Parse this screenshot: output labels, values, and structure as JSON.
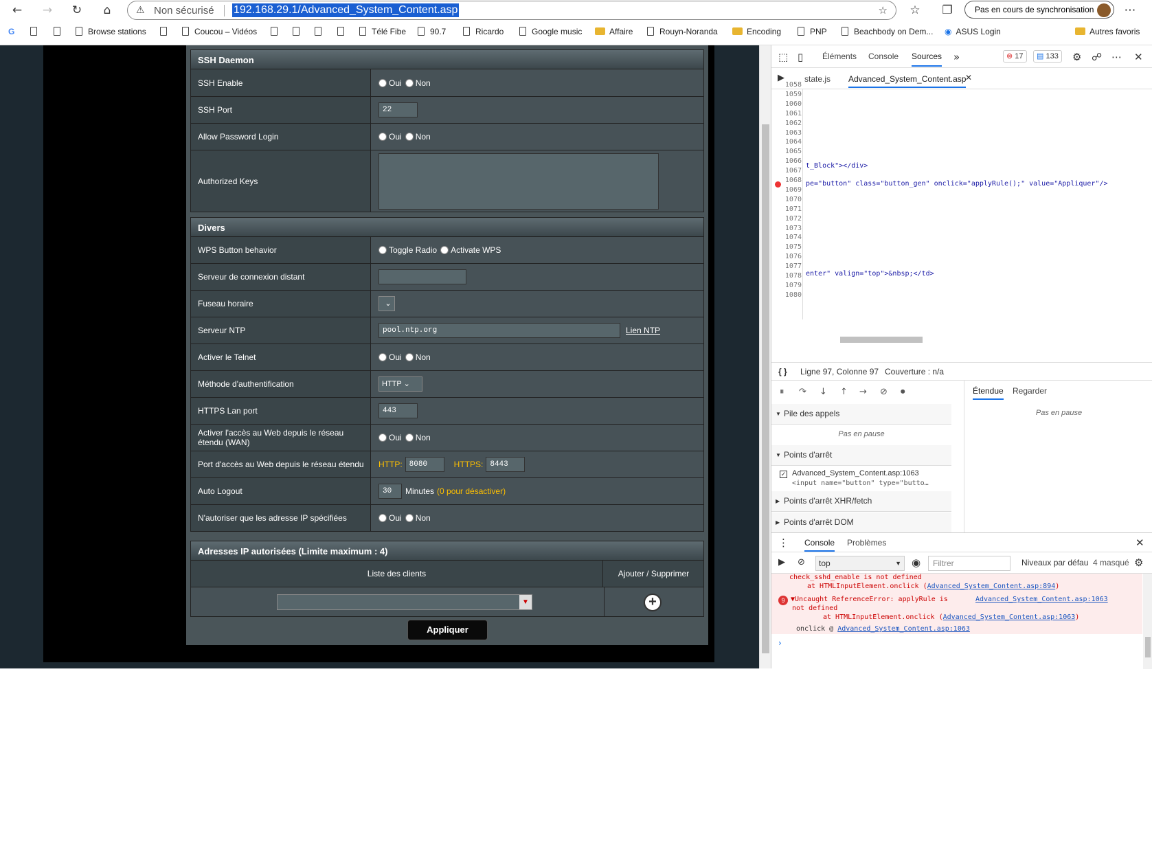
{
  "browser": {
    "not_secure": "Non sécurisé",
    "url": "192.168.29.1/Advanced_System_Content.asp",
    "sync": "Pas en cours de synchronisation",
    "bookmarks": [
      "Browse stations",
      "Coucou – Vidéos",
      "Télé Fibe",
      "90.7",
      "Ricardo",
      "Google music",
      "Affaire",
      "Rouyn-Noranda",
      "Encoding",
      "PNP",
      "Beachbody on Dem...",
      "ASUS Login",
      "Autres favoris"
    ]
  },
  "ssh": {
    "title": "SSH Daemon",
    "enable_label": "SSH Enable",
    "port_label": "SSH Port",
    "port_value": "22",
    "password_label": "Allow Password Login",
    "keys_label": "Authorized Keys",
    "oui": "Oui",
    "non": "Non"
  },
  "divers": {
    "title": "Divers",
    "wps_label": "WPS Button behavior",
    "wps_opt1": "Toggle Radio",
    "wps_opt2": "Activate WPS",
    "remote_label": "Serveur de connexion distant",
    "tz_label": "Fuseau horaire",
    "ntp_label": "Serveur NTP",
    "ntp_value": "pool.ntp.org",
    "ntp_link": "Lien NTP",
    "telnet_label": "Activer le Telnet",
    "auth_label": "Méthode d'authentification",
    "auth_value": "HTTP",
    "https_label": "HTTPS Lan port",
    "https_value": "443",
    "wan_label": "Activer l'accès au Web depuis le réseau étendu (WAN)",
    "wanport_label": "Port d'accès au Web depuis le réseau étendu",
    "http_tag": "HTTP:",
    "http_value": "8080",
    "https_tag": "HTTPS:",
    "https_wan_value": "8443",
    "logout_label": "Auto Logout",
    "logout_value": "30",
    "minutes": "Minutes",
    "logout_hint": "(0 pour désactiver)",
    "iponly_label": "N'autoriser que les adresse IP spécifiées"
  },
  "ips": {
    "title": "Adresses IP autorisées (Limite maximum : 4)",
    "col_clients": "Liste des clients",
    "col_add": "Ajouter / Supprimer"
  },
  "apply": "Appliquer",
  "devtools": {
    "tabs": [
      "Éléments",
      "Console",
      "Sources"
    ],
    "errors": "17",
    "messages": "133",
    "files": [
      "state.js",
      "Advanced_System_Content.asp"
    ],
    "lines": [
      "1058",
      "1059",
      "1060",
      "1061",
      "1062",
      "1063",
      "1064",
      "1065",
      "1066",
      "1067",
      "1068",
      "1069",
      "1070",
      "1071",
      "1072",
      "1073",
      "1074",
      "1075",
      "1076",
      "1077",
      "1078",
      "1079",
      "1080"
    ],
    "code_1061": "t_Block\"></div>",
    "code_1063": "pe=\"button\" class=\"button_gen\" onclick=\"applyRule();\" value=\"Appliquer\"/>",
    "code_1073": "enter\" valign=\"top\">&nbsp;</td>",
    "status_pos": "Ligne 97, Colonne 97",
    "status_cov": "Couverture : n/a",
    "scope": "Étendue",
    "watch": "Regarder",
    "not_paused": "Pas en pause",
    "callstack": "Pile des appels",
    "breakpoints": "Points d'arrêt",
    "bp_file": "Advanced_System_Content.asp:1063",
    "bp_code": "<input name=\"button\" type=\"butto…",
    "xhr": "Points d'arrêt XHR/fetch",
    "dom": "Points d'arrêt DOM",
    "console_tab": "Console",
    "problems_tab": "Problèmes",
    "context": "top",
    "filter": "Filtrer",
    "levels": "Niveaux par défau",
    "hidden": "4 masqué",
    "err0": "check_sshd_enable is not defined",
    "err1_at": "at HTMLInputElement.onclick (",
    "err1_link": "Advanced_System_Content.asp:894",
    "err2_count": "9",
    "err2": "Uncaught ReferenceError: applyRule is",
    "err2_b": "not defined",
    "err2_link": "Advanced_System_Content.asp:1063",
    "err2_at": "at HTMLInputElement.onclick (",
    "err2_link2": "Advanced_System_Content.asp:1063",
    "onclick": "onclick @",
    "onclick_link": "Advanced_System_Content.asp:1063"
  }
}
